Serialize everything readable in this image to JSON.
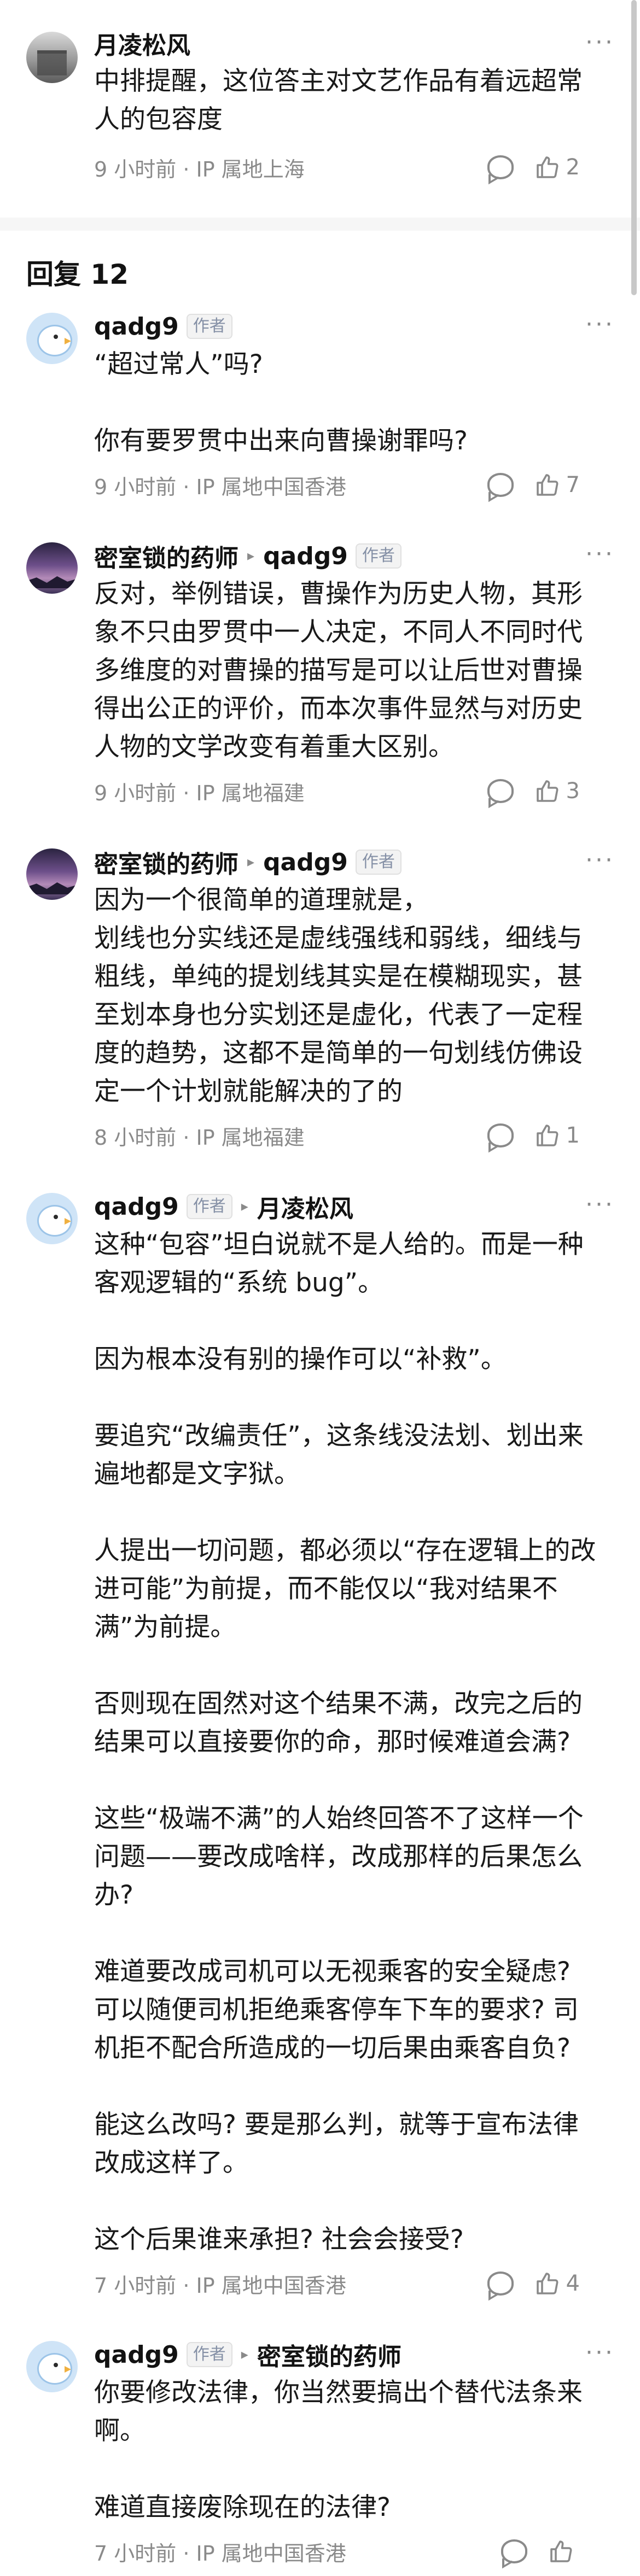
{
  "top_comment": {
    "author": "月凌松风",
    "text": "中排提醒，这位答主对文艺作品有着远超常人的包容度",
    "meta": "9 小时前 · IP 属地上海",
    "likes": "2"
  },
  "replies_header": "回复 12",
  "replies": [
    {
      "author": "qadg9",
      "author_tag": "作者",
      "text": "“超过常人”吗?\n\n你有要罗贯中出来向曹操谢罪吗?",
      "meta": "9 小时前 · IP 属地中国香港",
      "likes": "7"
    },
    {
      "author": "密室锁的药师",
      "reply_to": "qadg9",
      "reply_to_tag": "作者",
      "text": "反对，举例错误，曹操作为历史人物，其形象不只由罗贯中一人决定，不同人不同时代多维度的对曹操的描写是可以让后世对曹操得出公正的评价，而本次事件显然与对历史人物的文学改变有着重大区别。",
      "meta": "9 小时前 · IP 属地福建",
      "likes": "3"
    },
    {
      "author": "密室锁的药师",
      "reply_to": "qadg9",
      "reply_to_tag": "作者",
      "text": "因为一个很简单的道理就是，\n划线也分实线还是虚线强线和弱线，细线与粗线，单纯的提划线其实是在模糊现实，甚至划本身也分实划还是虚化，代表了一定程度的趋势，这都不是简单的一句划线仿佛设定一个计划就能解决的了的",
      "meta": "8 小时前 · IP 属地福建",
      "likes": "1"
    },
    {
      "author": "qadg9",
      "author_tag": "作者",
      "reply_to": "月凌松风",
      "text": "这种“包容”坦白说就不是人给的。而是一种客观逻辑的“系统 bug”。\n\n因为根本没有别的操作可以“补救”。\n\n要追究“改编责任”，这条线没法划、划出来遍地都是文字狱。\n\n人提出一切问题，都必须以“存在逻辑上的改进可能”为前提，而不能仅以“我对结果不满”为前提。\n\n否则现在固然对这个结果不满，改完之后的结果可以直接要你的命，那时候难道会满?\n\n这些“极端不满”的人始终回答不了这样一个问题——要改成啥样，改成那样的后果怎么办?\n\n难道要改成司机可以无视乘客的安全疑虑? 可以随便司机拒绝乘客停车下车的要求? 司机拒不配合所造成的一切后果由乘客自负?\n\n能这么改吗? 要是那么判，就等于宣布法律改成这样了。\n\n这个后果谁来承担? 社会会接受?",
      "meta": "7 小时前 · IP 属地中国香港",
      "likes": "4"
    },
    {
      "author": "qadg9",
      "author_tag": "作者",
      "reply_to": "密室锁的药师",
      "text": "你要修改法律，你当然要搞出个替代法条来啊。\n\n难道直接废除现在的法律?",
      "meta": "7 小时前 · IP 属地中国香港",
      "likes": ""
    }
  ],
  "icons": {
    "more": "more-dots-icon",
    "reply": "reply-bubble-icon",
    "like": "thumbs-up-icon"
  }
}
